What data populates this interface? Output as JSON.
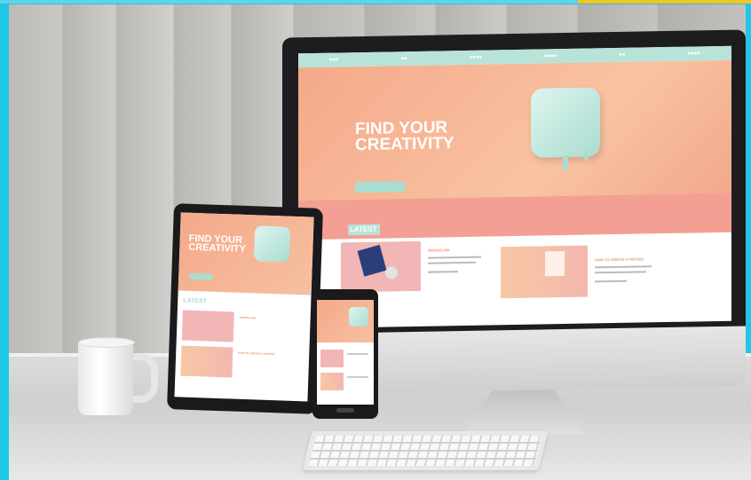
{
  "monitor": {
    "hero_title_line1": "FIND YOUR",
    "hero_title_line2": "CREATIVITY",
    "latest_label": "LATEST",
    "card1_title": "WORKFLOW",
    "card2_title": "HOW TO CREATE A POSTER"
  },
  "tablet": {
    "hero_title_line1": "FIND YOUR",
    "hero_title_line2": "CREATIVITY",
    "latest_label": "LATEST",
    "card1_title": "WORKFLOW",
    "card2_title": "HOW TO CREATE A POSTER"
  },
  "colors": {
    "peach": "#f4a98a",
    "mint": "#b8e3d8",
    "cyan_frame": "#1ec8e8",
    "yellow_accent": "#f7c323"
  }
}
